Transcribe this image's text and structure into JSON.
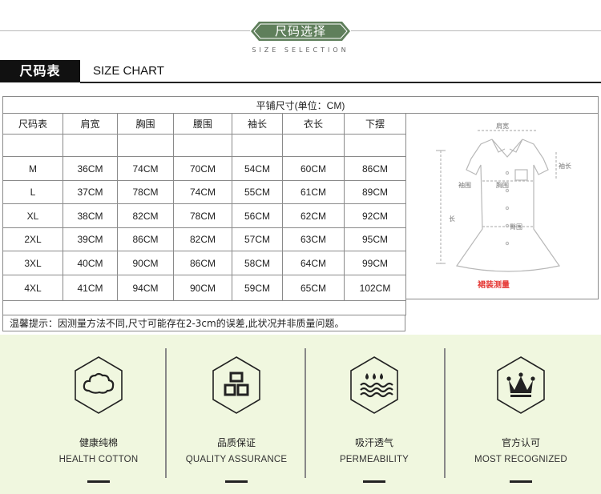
{
  "header": {
    "banner": "尺码选择",
    "subtitle": "SIZE SELECTION",
    "banner_color": "#5f7f5b"
  },
  "title_bar": {
    "tag": "尺码表",
    "title": "SIZE CHART"
  },
  "size_table": {
    "caption": "平铺尺寸(单位：CM)",
    "columns": [
      "尺码表",
      "肩宽",
      "胸围",
      "腰围",
      "袖长",
      "衣长",
      "下摆"
    ],
    "rows": [
      [
        "M",
        "36CM",
        "74CM",
        "70CM",
        "54CM",
        "60CM",
        "86CM"
      ],
      [
        "L",
        "37CM",
        "78CM",
        "74CM",
        "55CM",
        "61CM",
        "89CM"
      ],
      [
        "XL",
        "38CM",
        "82CM",
        "78CM",
        "56CM",
        "62CM",
        "92CM"
      ],
      [
        "2XL",
        "39CM",
        "86CM",
        "82CM",
        "57CM",
        "63CM",
        "95CM"
      ],
      [
        "3XL",
        "40CM",
        "90CM",
        "86CM",
        "58CM",
        "64CM",
        "99CM"
      ],
      [
        "4XL",
        "41CM",
        "94CM",
        "90CM",
        "59CM",
        "65CM",
        "102CM"
      ]
    ],
    "note": "温馨提示：因测量方法不同,尺寸可能存在2-3cm的误差,此状况并非质量问题。"
  },
  "diagram": {
    "labels": {
      "shoulder": "肩宽",
      "sleeve": "袖长",
      "armhole": "袖围",
      "chest": "胸围",
      "waist": "臀围",
      "length": "长"
    },
    "caption": "裙装测量",
    "caption_color": "#e53935"
  },
  "features": [
    {
      "icon": "cotton-cloud-icon",
      "cn": "健康纯棉",
      "en": "HEALTH COTTON"
    },
    {
      "icon": "quality-pin-icon",
      "cn": "品质保证",
      "en": "QUALITY ASSURANCE"
    },
    {
      "icon": "sweat-wave-icon",
      "cn": "吸汗透气",
      "en": "PERMEABILITY"
    },
    {
      "icon": "crown-icon",
      "cn": "官方认可",
      "en": "MOST RECOGNIZED"
    }
  ],
  "panel_color": "#f0f7df"
}
